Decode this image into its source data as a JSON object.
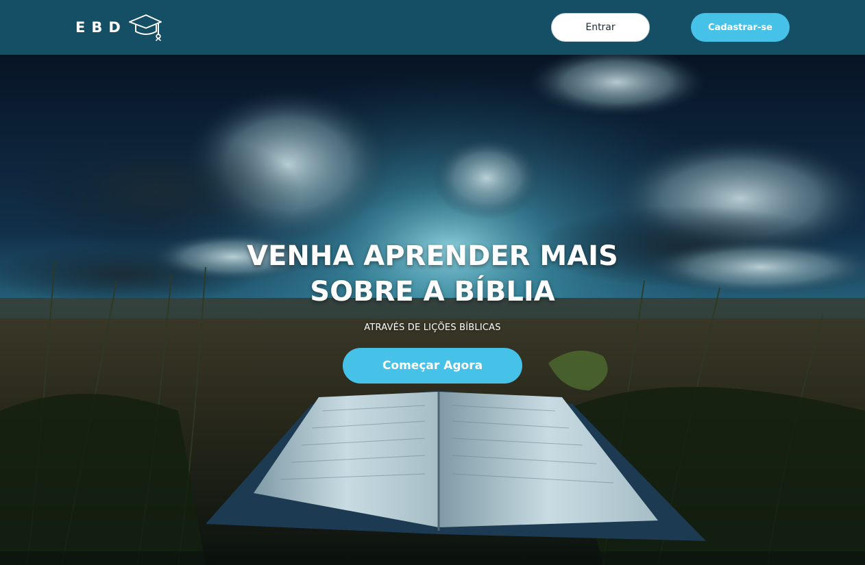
{
  "brand": {
    "logo_text": "EBD",
    "logo_icon": "graduation-cap-icon",
    "header_color": "#154f66"
  },
  "nav": {
    "login_label": "Entrar",
    "signup_label": "Cadastrar-se",
    "signup_color": "#46c1e8"
  },
  "hero": {
    "title_line1": "VENHA APRENDER MAIS",
    "title_line2": "SOBRE A BÍBLIA",
    "subtitle": "ATRAVÉS DE LIÇÕES BÍBLICAS",
    "cta_label": "Começar Agora",
    "cta_color": "#46c1e8",
    "background_image": "open-bible-in-field-at-night-image"
  }
}
